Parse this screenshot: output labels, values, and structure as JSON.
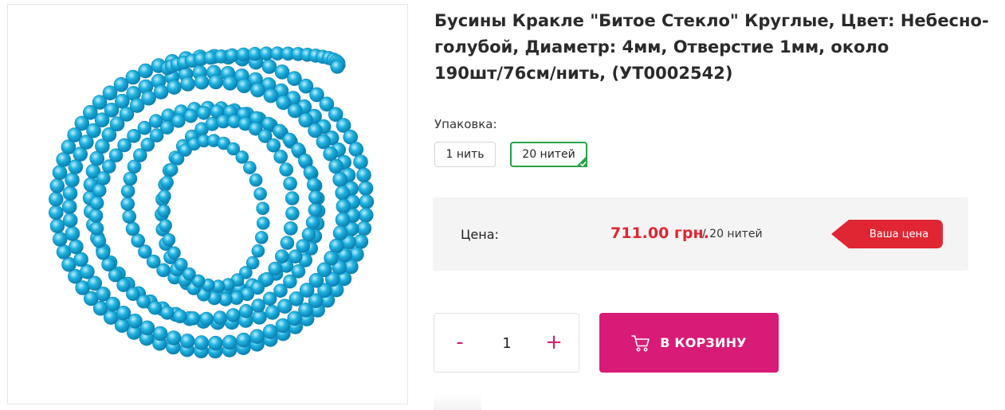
{
  "product": {
    "title": "Бусины Кракле \"Битое Стекло\" Круглые, Цвет: Небесно-голубой, Диаметр: 4мм, Отверстие 1мм, около 190шт/76см/нить, (УТ0002542)",
    "image_alt": "Бусины Кракле небесно-голубые",
    "bead_color": "#1fb3e0"
  },
  "packaging": {
    "label": "Упаковка:",
    "options": [
      {
        "label": "1 нить",
        "selected": false
      },
      {
        "label": "20 нитей",
        "selected": true
      }
    ],
    "selected_color": "#27a24a"
  },
  "price": {
    "label": "Цена:",
    "value": "711.00 грн.",
    "unit": "/ 20 нитей",
    "badge": "Ваша цена",
    "value_color": "#e02633",
    "badge_color": "#e02633"
  },
  "quantity": {
    "minus": "-",
    "value": "1",
    "plus": "+"
  },
  "cart": {
    "label": "В КОРЗИНУ",
    "icon": "cart-icon",
    "color": "#d81b77"
  }
}
